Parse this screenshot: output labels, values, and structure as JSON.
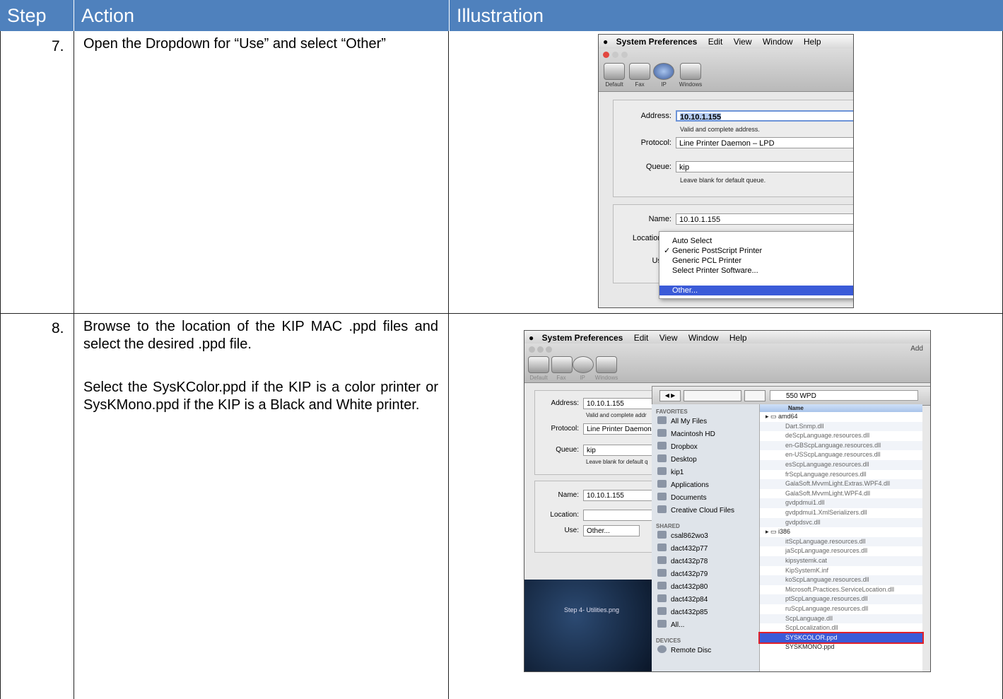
{
  "header": {
    "step_label": "Step",
    "action_label": "Action",
    "illustration_label": "Illustration"
  },
  "colors": {
    "header_bg": "#4f81bd",
    "highlight_blue": "#3b5bd8",
    "highlight_red": "#e0202a"
  },
  "rows": [
    {
      "number": "7.",
      "action": "Open the Dropdown for “Use” and select “Other”"
    },
    {
      "number": "8.",
      "action_p1": "Browse to the location of the KIP MAC .ppd files and select the desired .ppd file.",
      "action_p2": "Select the SysKColor.ppd if the KIP is a color printer or SysKMono.ppd if the KIP is a Black and White printer."
    }
  ],
  "shot1": {
    "menubar": {
      "app": "System Preferences",
      "items": [
        "Edit",
        "View",
        "Window",
        "Help"
      ]
    },
    "toolbar": [
      "Default",
      "Fax",
      "IP",
      "Windows"
    ],
    "address_label": "Address:",
    "address_value": "10.10.1.155",
    "address_hint": "Valid and complete address.",
    "protocol_label": "Protocol:",
    "protocol_value": "Line Printer Daemon – LPD",
    "queue_label": "Queue:",
    "queue_value": "kip",
    "queue_hint": "Leave blank for default queue.",
    "name_label": "Name:",
    "name_value": "10.10.1.155",
    "location_label": "Locatior",
    "use_label": "Use",
    "menu_items": [
      "Auto Select",
      "Generic PostScript Printer",
      "Generic PCL Printer",
      "Select Printer Software...",
      "Other..."
    ],
    "checked": "✓"
  },
  "shot2": {
    "menubar": {
      "app": "System Preferences",
      "items": [
        "Edit",
        "View",
        "Window",
        "Help"
      ]
    },
    "add_label": "Add",
    "toolbar": [
      "Default",
      "Fax",
      "IP",
      "Windows"
    ],
    "address_label": "Address:",
    "address_value": "10.10.1.155",
    "address_hint": "Valid and complete addr",
    "protocol_label": "Protocol:",
    "protocol_value": "Line Printer Daemon",
    "queue_label": "Queue:",
    "queue_value": "kip",
    "queue_hint": "Leave blank for default q",
    "name_label": "Name:",
    "name_value": "10.10.1.155",
    "location_label": "Location:",
    "use_label": "Use:",
    "use_value": "Other...",
    "folder": "550 WPD",
    "desktop_icon": "Step 4- Utilities.png",
    "favorites_label": "FAVORITES",
    "favorites": [
      "All My Files",
      "Macintosh HD",
      "Dropbox",
      "Desktop",
      "kip1",
      "Applications",
      "Documents",
      "Creative Cloud Files"
    ],
    "shared_label": "SHARED",
    "shared": [
      "csal862wo3",
      "dact432p77",
      "dact432p78",
      "dact432p79",
      "dact432p80",
      "dact432p84",
      "dact432p85",
      "All..."
    ],
    "devices_label": "DEVICES",
    "devices": [
      "Remote Disc"
    ],
    "name_col": "Name",
    "files": [
      "amd64",
      "Dart.Snmp.dll",
      "deScpLanguage.resources.dll",
      "en-GBScpLanguage.resources.dll",
      "en-USScpLanguage.resources.dll",
      "esScpLanguage.resources.dll",
      "frScpLanguage.resources.dll",
      "GalaSoft.MvvmLight.Extras.WPF4.dll",
      "GalaSoft.MvvmLight.WPF4.dll",
      "gvdpdmui1.dll",
      "gvdpdmui1.XmlSerializers.dll",
      "gvdpdsvc.dll",
      "i386",
      "itScpLanguage.resources.dll",
      "jaScpLanguage.resources.dll",
      "kipsystemk.cat",
      "KipSystemK.inf",
      "koScpLanguage.resources.dll",
      "Microsoft.Practices.ServiceLocation.dll",
      "ptScpLanguage.resources.dll",
      "ruScpLanguage.resources.dll",
      "ScpLanguage.dll",
      "ScpLocalization.dll",
      "SYSKCOLOR.ppd",
      "SYSKMONO.ppd"
    ]
  }
}
